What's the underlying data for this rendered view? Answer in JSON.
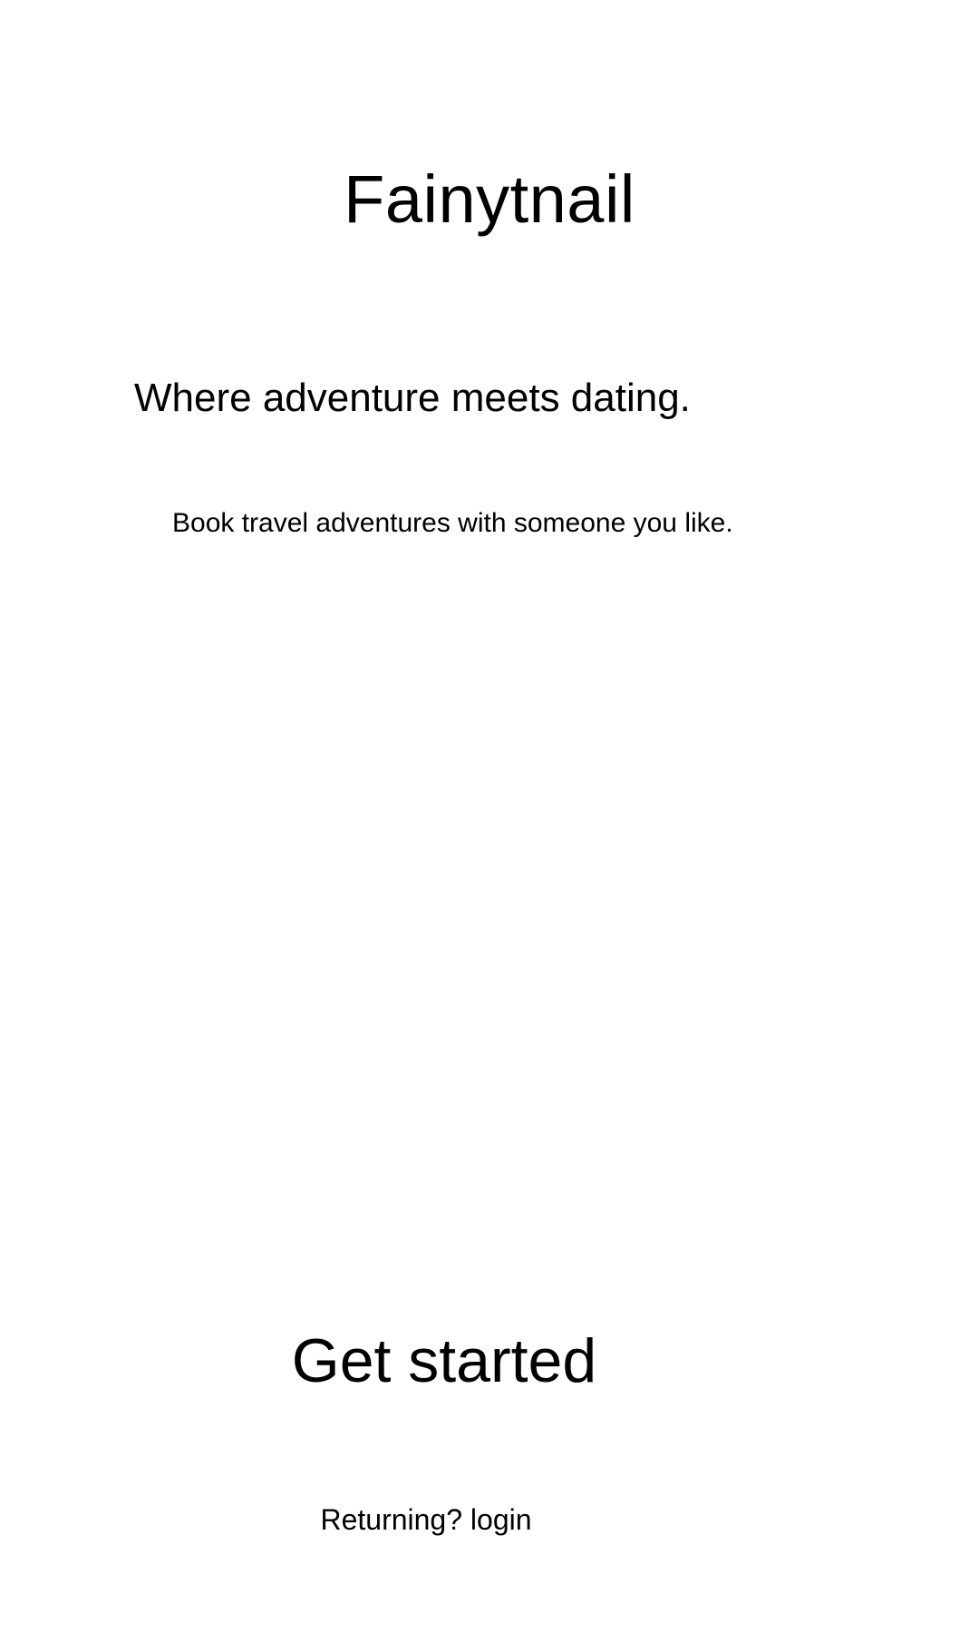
{
  "app": {
    "title": "Fainytnail",
    "tagline": "Where adventure meets dating.",
    "subtitle": "Book travel adventures with someone you like."
  },
  "actions": {
    "get_started_label": "Get started",
    "login_label": "Returning? login"
  },
  "colors": {
    "background": "#ffffff",
    "text": "#000000"
  }
}
